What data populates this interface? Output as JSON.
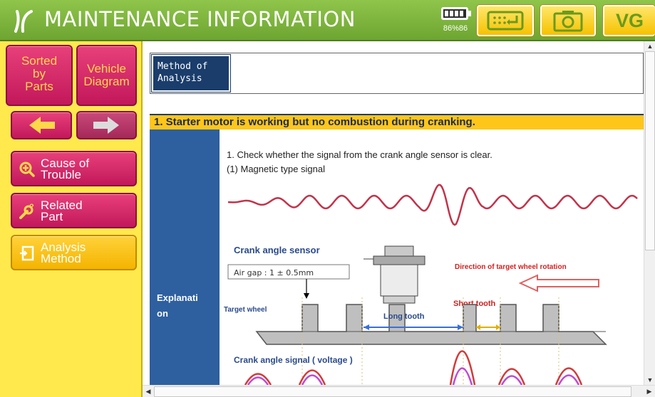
{
  "titlebar": {
    "title": "MAINTENANCE INFORMATION",
    "battery_label": "86%86",
    "vg_label": "VG",
    "icons": [
      "app-logo-icon",
      "battery-icon",
      "keyboard-enter-icon",
      "camera-icon"
    ]
  },
  "sidebar": {
    "sorted_by_parts": [
      "Sorted",
      "by",
      "Parts"
    ],
    "vehicle_diagram": [
      "Vehicle",
      "Diagram"
    ],
    "prev_icon": "arrow-left-icon",
    "next_icon": "arrow-right-icon",
    "cause_of_trouble": [
      "Cause of",
      "Trouble"
    ],
    "related_part": [
      "Related",
      "Part"
    ],
    "analysis_method": [
      "Analysis",
      "Method"
    ]
  },
  "content": {
    "method_label": [
      "Method of",
      "Analysis"
    ],
    "method_value": "",
    "section_title": "1. Starter motor is working but no combustion during cranking.",
    "explanation_label": [
      "Explanati",
      "on"
    ],
    "text_lines": [
      "1. Check whether the signal from the crank angle sensor is clear.",
      "(1) Magnetic type signal"
    ],
    "diagram": {
      "sensor_label": "Crank angle sensor",
      "air_gap": "Air gap : 1 ± 0.5mm",
      "direction_label": "Direction of target wheel rotation",
      "short_tooth": "Short tooth",
      "long_tooth": "Long tooth",
      "target_wheel": "Target wheel",
      "signal_label": "Crank angle signal ( voltage )"
    }
  },
  "colors": {
    "titlebar_green": "#7bb33c",
    "sidebar_yellow": "#ffe94d",
    "button_magenta": "#c2185b",
    "button_gold": "#f4b400",
    "header_navy": "#1a3d6b",
    "section_orange": "#ffc61a",
    "explain_blue": "#2e5f9f"
  }
}
